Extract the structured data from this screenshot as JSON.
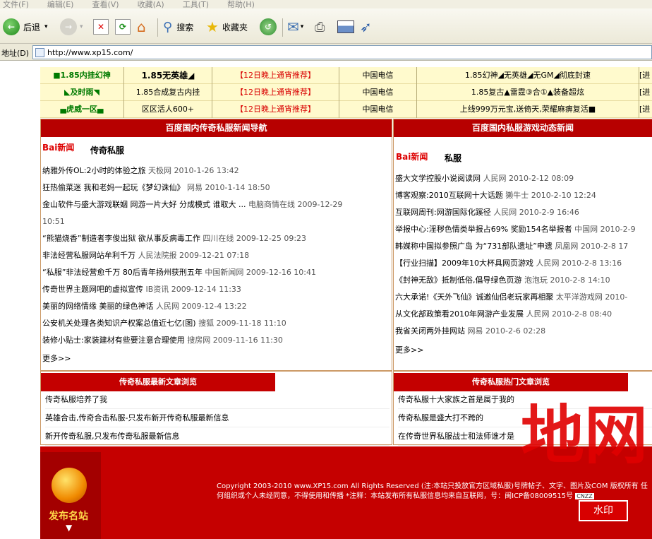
{
  "menubar": [
    "文件(F)",
    "编辑(E)",
    "查看(V)",
    "收藏(A)",
    "工具(T)",
    "帮助(H)"
  ],
  "toolbar": {
    "back": "后退",
    "search": "搜索",
    "favorites": "收藏夹"
  },
  "address": {
    "label": "地址(D)",
    "url": "http://www.xp15.com/"
  },
  "server_rows": [
    {
      "name": "■1.85内挂幻神",
      "version": "1.85无英雄◢",
      "time": "【12日晚上通宵推荐】",
      "isp": "中国电信",
      "desc": "1.85幻神◢无英雄◢无GM◢彻底封速",
      "more": "[进"
    },
    {
      "name": "◣及时雨◥",
      "version": "1.85合成复古内挂",
      "time": "【12日晚上通宵推荐】",
      "isp": "中国电信",
      "desc": "1.85复古▲雷霆③合①▲装备超炫",
      "more": "[进"
    },
    {
      "name": "▄虎威一区▄",
      "version": "区区活人600+",
      "time": "【12日晚上通宵推荐】",
      "isp": "中国电信",
      "desc": "上线999万元宝,送倚天,荣耀麻痹复活■",
      "more": "[进"
    }
  ],
  "left_panel": {
    "title": "百度国内传奇私服新闻导航",
    "logo": "Bai新闻",
    "keyword": "传奇私服",
    "more": "更多>>",
    "items": [
      {
        "title": "纳雅外传OL:2小时的体验之旅",
        "src": "天极网",
        "date": "2010-1-26 13:42"
      },
      {
        "title": "狂热偷菜迷 我和老妈一起玩《梦幻诛仙》",
        "src": "网易",
        "date": "2010-1-14 18:50"
      },
      {
        "title": "金山软件与盛大游戏联姻 网游一片大好 分成模式 谁取大 ...",
        "src": "电脑商情在线",
        "date": "2009-12-29"
      },
      {
        "title": "",
        "src": "",
        "date": "10:51"
      },
      {
        "title": "“熊猫烧香”制造者李俊出狱 欲从事反病毒工作",
        "src": "四川在线",
        "date": "2009-12-25 09:23"
      },
      {
        "title": "非法经营私服网站牟利千万",
        "src": "人民法院报",
        "date": "2009-12-21 07:18"
      },
      {
        "title": "“私服”非法经营愈千万 80后青年扬州获刑五年",
        "src": "中国新闻网",
        "date": "2009-12-16 10:41"
      },
      {
        "title": "传奇世界主题网吧的虚拟宣传",
        "src": "IB资讯",
        "date": "2009-12-14 11:33"
      },
      {
        "title": "美丽的网络情缘 美丽的绿色神话",
        "src": "人民网",
        "date": "2009-12-4 13:22"
      },
      {
        "title": "公安机关处理各类知识产权案总值近七亿(图)",
        "src": "搜狐",
        "date": "2009-11-18 11:10"
      },
      {
        "title": "装修小贴士:家装建材有些要注意合理使用",
        "src": "搜房网",
        "date": "2009-11-16 11:30"
      }
    ]
  },
  "right_panel": {
    "title": "百度国内私服游戏动态新闻",
    "logo": "Bai新闻",
    "keyword": "私服",
    "more": "更多>>",
    "items": [
      {
        "title": "盛大文学控股小说阅读网",
        "src": "人民网",
        "date": "2010-2-12 08:09"
      },
      {
        "title": "博客观察:2010互联网十大话题",
        "src": "獭牛士",
        "date": "2010-2-10 12:24"
      },
      {
        "title": "互联网周刊:网游国际化蹊径",
        "src": "人民网",
        "date": "2010-2-9 16:46"
      },
      {
        "title": "举报中心:淫秽色情类举报占69% 奖励154名举报者",
        "src": "中国网",
        "date": "2010-2-9"
      },
      {
        "title": "韩媒称中国拟参照广岛 为“731部队遗址”申遗",
        "src": "凤凰网",
        "date": "2010-2-8 17"
      },
      {
        "title": "【行业扫描】2009年10大杯具网页游戏",
        "src": "人民网",
        "date": "2010-2-8 13:16"
      },
      {
        "title": "《封神无敌》抵制低俗,倡导绿色页游",
        "src": "泡泡玩",
        "date": "2010-2-8 14:10"
      },
      {
        "title": "六大承诺!《天外飞仙》诚邀仙侣老玩家再相聚",
        "src": "太平洋游戏网",
        "date": "2010-"
      },
      {
        "title": "从文化部政策看2010年网游产业发展",
        "src": "人民网",
        "date": "2010-2-8 08:40"
      },
      {
        "title": "我省关闭两外挂网站",
        "src": "网易",
        "date": "2010-2-6 02:28"
      }
    ]
  },
  "latest": {
    "title": "传奇私服最新文章浏览",
    "items": [
      "传奇私服培养了我",
      "英雄合击,传奇合击私服-只发布新开传奇私服最新信息",
      "新开传奇私服,只发布传奇私服最新信息"
    ]
  },
  "hot": {
    "title": "传奇私服热门文章浏览",
    "items": [
      "传奇私服十大家族之首是属于我的",
      "传奇私服是盛大打不跨的",
      "在传奇世界私服战士和法师谁才是"
    ]
  },
  "footer": {
    "logo_text": "发布名站",
    "copyright": "Copyright 2003-2010 www.XP15.com All Rights Reserved (注:本站只投放官方区域私服)号牌帖子、文字、图片及COM 版权所有 任何组织或个人未经同意，不得使用和传播 *注释：本站发布所有私服信息均来自互联网，号：闽ICP备08009515号",
    "badge": "CNZZ"
  },
  "watermark": {
    "big": "地网",
    "seal": "水印"
  },
  "colors": {
    "header_red": "#b70000",
    "row_bg": "#fffacd"
  }
}
